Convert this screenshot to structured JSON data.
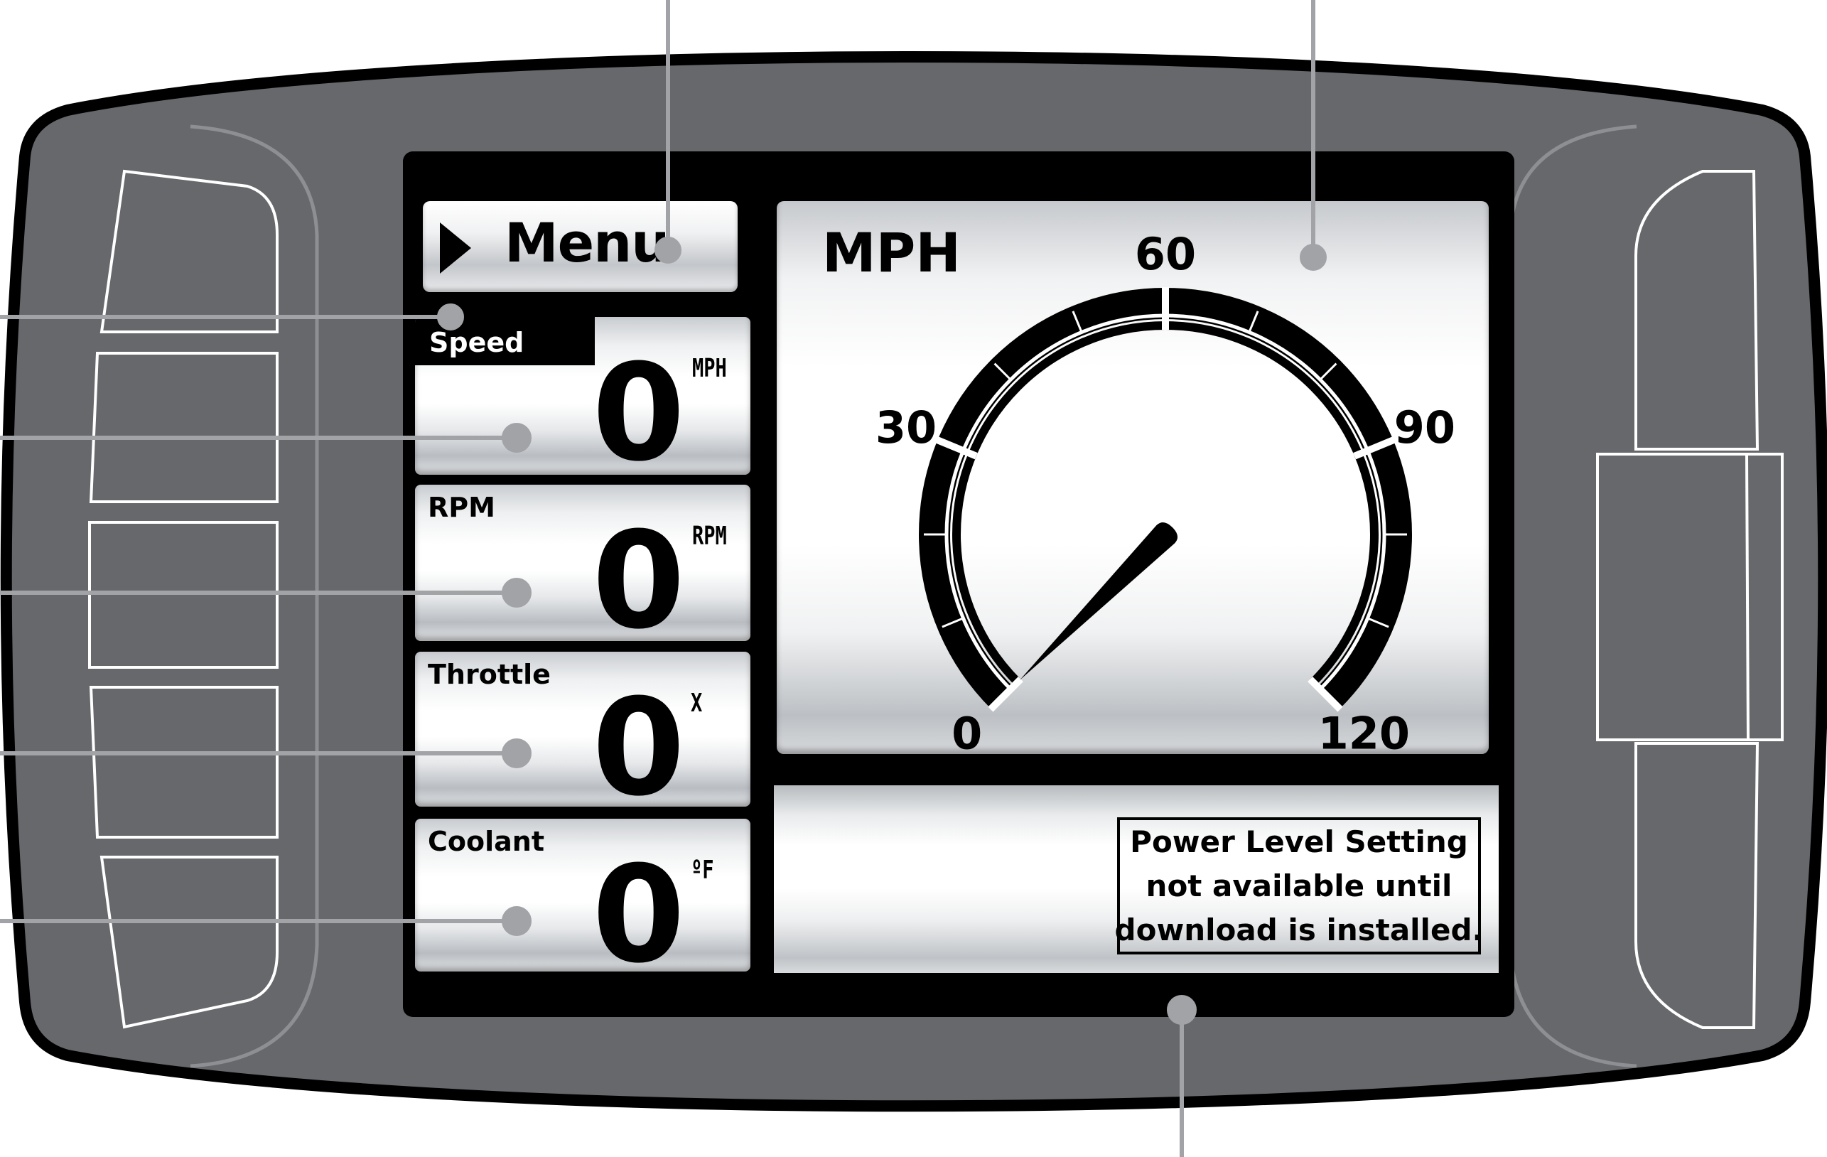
{
  "menu": {
    "label": "Menu"
  },
  "main_gauge": {
    "unit_label": "MPH",
    "scale_labels": [
      "0",
      "30",
      "60",
      "90",
      "120"
    ],
    "scale_min": 0,
    "scale_max": 120,
    "needle_value": 0
  },
  "side_gauges": [
    {
      "label": "Speed",
      "value": "0",
      "unit": "MPH"
    },
    {
      "label": "RPM",
      "value": "0",
      "unit": "RPM"
    },
    {
      "label": "Throttle",
      "value": "0",
      "unit": "X"
    },
    {
      "label": "Coolant",
      "value": "0",
      "unit": "ºF"
    }
  ],
  "status_panel": {
    "message_lines": [
      "Power Level Setting",
      "not available until",
      "download is installed."
    ]
  },
  "colors": {
    "bezel": "#67686c",
    "bezel_outline": "#000000",
    "screen_background": "#000000",
    "callout_line": "#a2a3a6",
    "button_outline": "#ffffff"
  }
}
